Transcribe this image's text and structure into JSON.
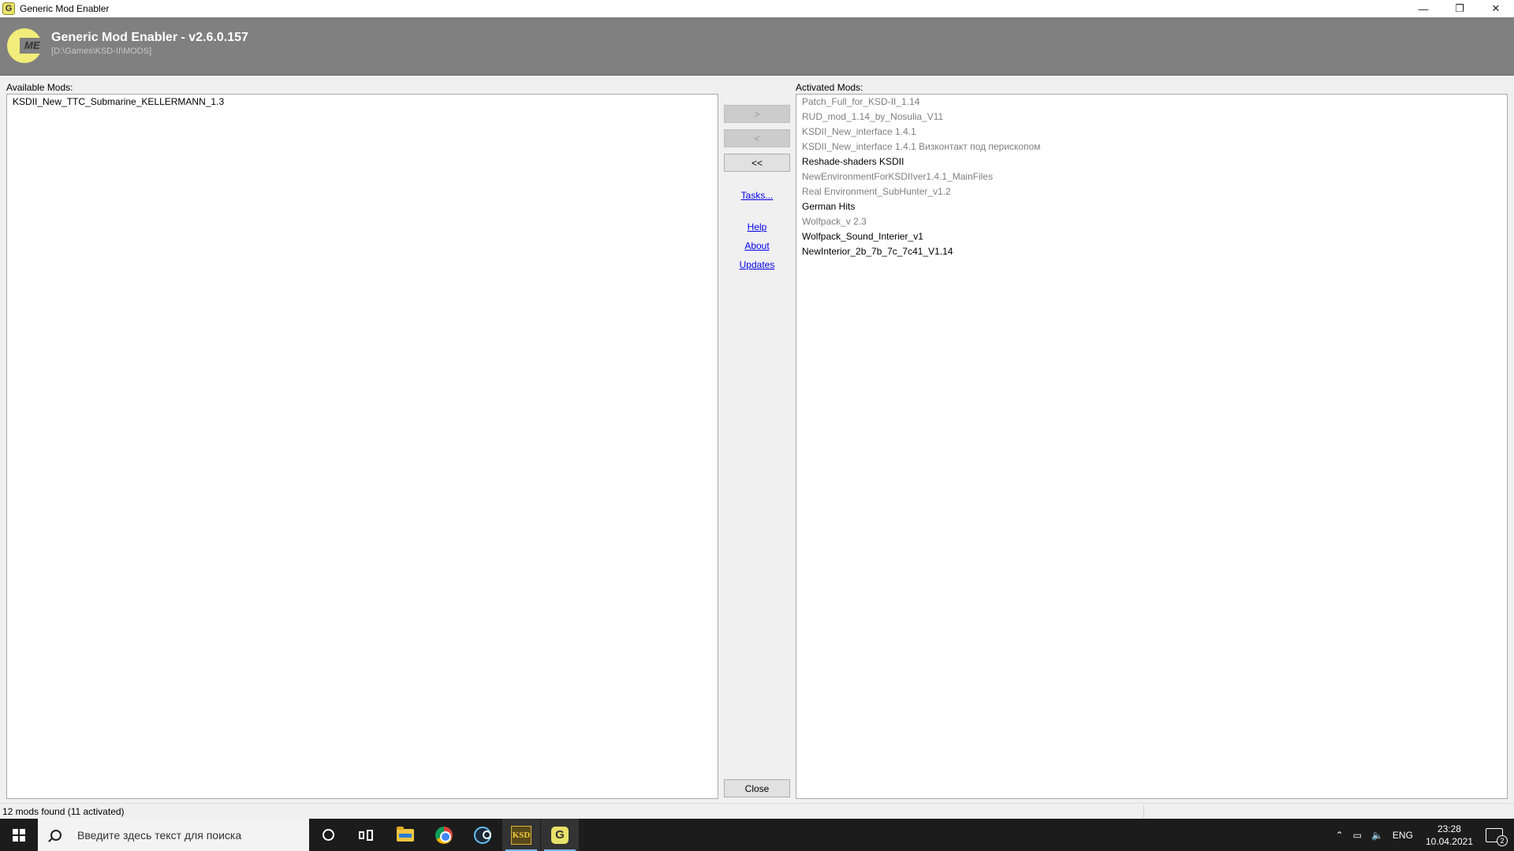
{
  "window": {
    "title": "Generic Mod Enabler",
    "controls": {
      "minimize": "—",
      "restore": "❐",
      "close": "✕"
    }
  },
  "header": {
    "logo_text": "ME",
    "app_name": "Generic Mod Enabler - v2.6.0.157",
    "path": "[D:\\Games\\KSD-II\\MODS]"
  },
  "available": {
    "label": "Available Mods:",
    "items": [
      "KSDII_New_TTC_Submarine_KELLERMANN_1.3"
    ]
  },
  "activated": {
    "label": "Activated Mods:",
    "items": [
      {
        "name": "Patch_Full_for_KSD-II_1.14",
        "dim": true
      },
      {
        "name": "RUD_mod_1.14_by_Nosulia_V11",
        "dim": true
      },
      {
        "name": "KSDII_New_interface 1.4.1",
        "dim": true
      },
      {
        "name": "KSDII_New_interface 1.4.1 Визконтакт под перископом",
        "dim": true
      },
      {
        "name": "Reshade-shaders KSDII",
        "dim": false
      },
      {
        "name": "NewEnvironmentForKSDIIver1.4.1_MainFiles",
        "dim": true
      },
      {
        "name": "Real Environment_SubHunter_v1.2",
        "dim": true
      },
      {
        "name": "German Hits",
        "dim": false
      },
      {
        "name": "Wolfpack_v 2.3",
        "dim": true
      },
      {
        "name": "Wolfpack_Sound_Interier_v1",
        "dim": false
      },
      {
        "name": "NewInterior_2b_7b_7c_7c41_V1.14",
        "dim": false
      }
    ]
  },
  "controls": {
    "activate": ">",
    "deactivate": "<",
    "deactivate_all": "<<",
    "tasks": "Tasks...",
    "help": "Help",
    "about": "About",
    "updates": "Updates",
    "close": "Close"
  },
  "status": {
    "text": "12 mods found (11 activated)"
  },
  "taskbar": {
    "search_placeholder": "Введите здесь текст для поиска",
    "ksd_label": "KSD",
    "gme_label": "G",
    "tray_language": "ENG",
    "time": "23:28",
    "date": "10.04.2021",
    "notification_count": "2"
  }
}
